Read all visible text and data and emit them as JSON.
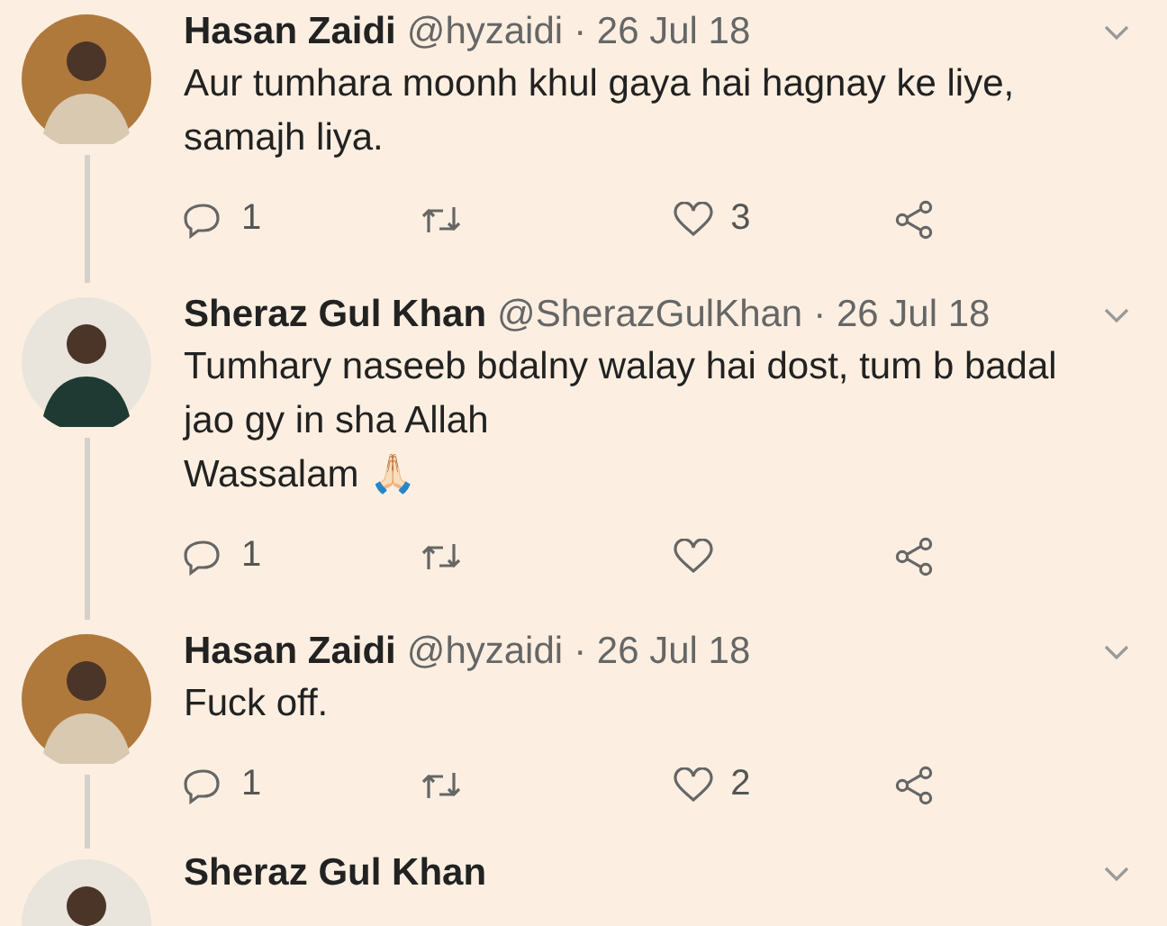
{
  "tweets": [
    {
      "name": "Hasan Zaidi",
      "handle": "@hyzaidi",
      "date": "· 26 Jul 18",
      "lines": [
        "Aur tumhara moonh khul gaya hai hagnay ke liye, samajh liya."
      ],
      "replies": "1",
      "likes": "3"
    },
    {
      "name": "Sheraz Gul Khan",
      "handle": "@SherazGulKhan",
      "date": "· 26 Jul 18",
      "lines": [
        "Tumhary naseeb bdalny walay hai dost, tum b badal jao gy in sha Allah",
        "Wassalam 🙏🏻"
      ],
      "replies": "1"
    },
    {
      "name": "Hasan Zaidi",
      "handle": "@hyzaidi",
      "date": "· 26 Jul 18",
      "lines": [
        "Fuck off."
      ],
      "replies": "1",
      "likes": "2"
    },
    {
      "name": "Sheraz Gul Khan",
      "kind": "partial"
    }
  ]
}
